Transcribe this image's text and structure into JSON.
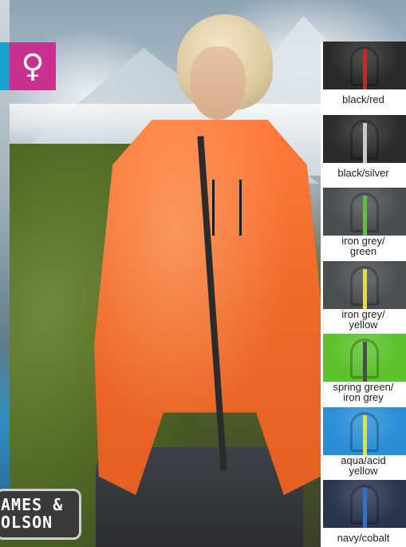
{
  "badge": {
    "symbol": "♀"
  },
  "brand": {
    "line1": "AMES &",
    "line2": "OLSON"
  },
  "swatches": [
    {
      "label": "black/red",
      "body": "#2a2a2a",
      "accent": "#d2231e"
    },
    {
      "label": "black/silver",
      "body": "#2b2b2b",
      "accent": "#c9c9c9"
    },
    {
      "label": "iron grey/\ngreen",
      "body": "#4a4d52",
      "accent": "#5bc23a"
    },
    {
      "label": "iron grey/\nyellow",
      "body": "#4b4e53",
      "accent": "#e4e02c"
    },
    {
      "label": "spring green/\niron grey",
      "body": "#5cc22c",
      "accent": "#4a4d52"
    },
    {
      "label": "aqua/acid\nyellow",
      "body": "#2a8fd6",
      "accent": "#dfe62a"
    },
    {
      "label": "navy/cobalt",
      "body": "#2a3650",
      "accent": "#2f6fd1"
    }
  ],
  "colors": {
    "jacket": "#f06a2a",
    "badge": "#c8318f",
    "tab": "#1da1cf"
  }
}
